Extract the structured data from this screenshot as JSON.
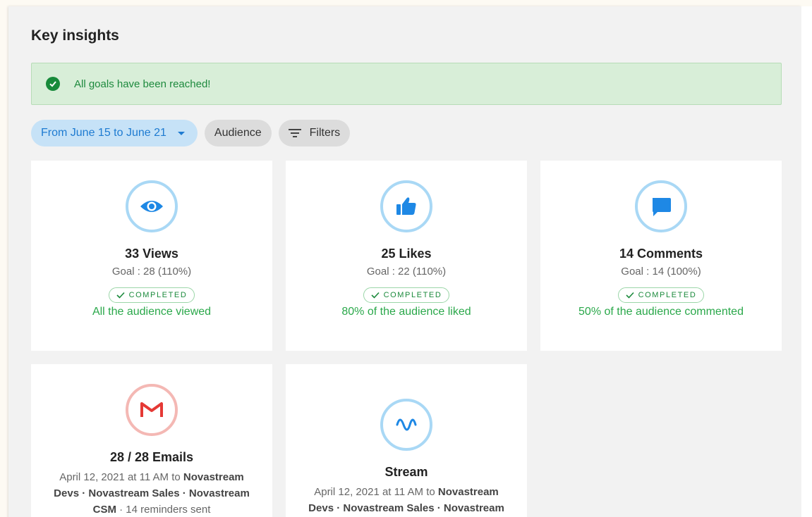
{
  "page": {
    "title": "Key insights"
  },
  "banner": {
    "message": "All goals have been reached!",
    "icon": "check-circle-icon"
  },
  "chips": {
    "date_range": "From June 15 to June 21",
    "audience": "Audience",
    "filters": "Filters"
  },
  "cards": [
    {
      "title": "33 Views",
      "goal": "Goal : 28 (110%)",
      "badge": "COMPLETED",
      "subtitle": "All the audience viewed",
      "icon": "eye-icon"
    },
    {
      "title": "25 Likes",
      "goal": "Goal : 22 (110%)",
      "badge": "COMPLETED",
      "subtitle": "80% of the audience liked",
      "icon": "thumbs-up-icon"
    },
    {
      "title": "14 Comments",
      "goal": "Goal : 14 (100%)",
      "badge": "COMPLETED",
      "subtitle": "50% of the audience commented",
      "icon": "comment-icon"
    },
    {
      "title": "28 / 28 Emails",
      "desc_prefix": "April 12, 2021 at 11 AM to ",
      "desc_bold": "Novastream Devs · Novastream Sales · Novastream CSM",
      "desc_suffix": " · 14 reminders sent",
      "icon": "gmail-icon"
    },
    {
      "title": "Stream",
      "desc_prefix": "April 12, 2021 at 11 AM to ",
      "desc_bold": "Novastream Devs · Novastream Sales · Novastream",
      "icon": "wave-icon"
    }
  ],
  "colors": {
    "accent": "#1e7bd1",
    "success": "#1b8a3c",
    "banner_bg": "#d8eed8"
  }
}
